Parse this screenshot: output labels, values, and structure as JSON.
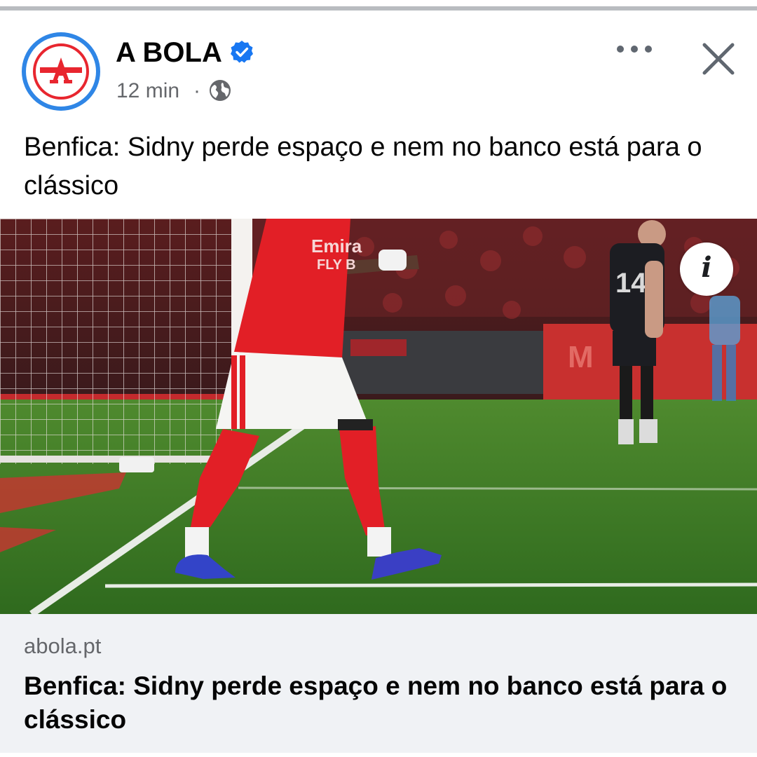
{
  "post": {
    "page_name": "A BOLA",
    "avatar_letter": "A",
    "verified": true,
    "time": "12 min",
    "separator": "·",
    "audience_icon": "globe-icon",
    "headline": "Benfica: Sidny perde espaço e nem no banco está para o clássico"
  },
  "actions": {
    "more_icon": "more-dots-icon",
    "close_icon": "close-icon"
  },
  "image": {
    "info_icon": "i",
    "jersey_text_1": "Emira",
    "jersey_text_2": "FLY B",
    "opponent_number": "14",
    "ad_board_text": "M"
  },
  "link_card": {
    "domain": "abola.pt",
    "title": "Benfica: Sidny perde espaço e nem no banco está para o clássico"
  },
  "colors": {
    "brand_red": "#e8262f",
    "verified_blue": "#1877f2",
    "text_primary": "#050505",
    "text_secondary": "#65676b",
    "card_bg": "#f0f2f5"
  }
}
